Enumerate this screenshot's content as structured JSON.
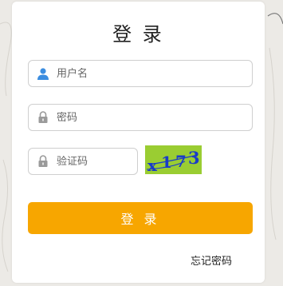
{
  "page": {
    "background": "#eceae6"
  },
  "login": {
    "title": "登 录",
    "username_placeholder": "用户名",
    "password_placeholder": "密码",
    "captcha_placeholder": "验证码",
    "captcha_image": {
      "text": "x-1-7-3",
      "background": "#9acd32",
      "text_color": "#1a3cc8"
    },
    "submit_label": "登 录",
    "submit_color": "#f7a600",
    "forgot_label": "忘记密码"
  },
  "icons": {
    "user": "user-icon",
    "lock": "lock-icon"
  }
}
